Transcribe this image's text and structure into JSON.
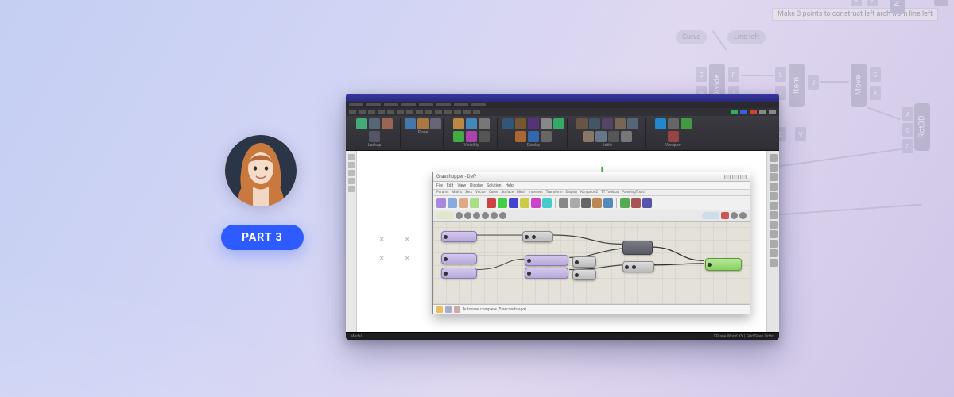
{
  "badge": {
    "label": "PART 3"
  },
  "bg": {
    "tooltip": "Make 3 points to construct left arch from line left",
    "pills": [
      "Curve",
      "Line left"
    ],
    "nodes": [
      "Divide",
      "Item",
      "Move",
      "Rot3D",
      "Neg",
      "R"
    ],
    "ports": [
      "C",
      "N",
      "P",
      "I",
      "W",
      "L",
      "i",
      "J",
      "G",
      "X",
      "Z",
      "V",
      "A",
      "G",
      "C",
      "A"
    ]
  },
  "window": {
    "ribbon_groups": [
      "Lookup",
      "Plane",
      "Visibility",
      "Display",
      "Entity",
      "Viewport"
    ],
    "statusbar_left": "Model",
    "statusbar_right": "CPlane   World XY  |  Grid Snap  Ortho"
  },
  "gh": {
    "title": "Grasshopper - Def*",
    "menu": [
      "File",
      "Edit",
      "View",
      "Display",
      "Solution",
      "Help"
    ],
    "tabs": [
      "Params",
      "Maths",
      "Sets",
      "Vector",
      "Curve",
      "Surface",
      "Mesh",
      "Intersect",
      "Transform",
      "Display",
      "Kangaroo2",
      "TT Toolbox",
      "PanelingTools"
    ],
    "status": "Autosave complete (5 seconds ago)"
  }
}
